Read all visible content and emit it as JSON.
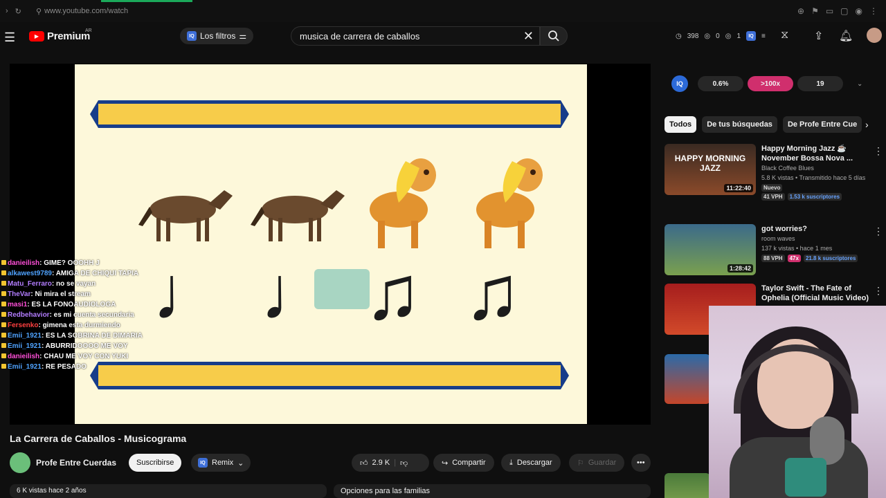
{
  "browser": {
    "url": "www.youtube.com/watch"
  },
  "header": {
    "logo_text": "Premium",
    "logo_region": "AR",
    "filters_label": "Los filtros",
    "search_value": "musica de carrera de caballos",
    "stats": {
      "views": "398",
      "a": "0",
      "b": "1"
    }
  },
  "video": {
    "title": "La Carrera de Caballos - Musicograma",
    "channel": "Profe Entre Cuerdas",
    "subscribe_label": "Suscribirse",
    "remix_label": "Remix",
    "likes": "2.9 K",
    "share_label": "Compartir",
    "download_label": "Descargar",
    "save_label": "Guardar",
    "family_options": "Opciones para las familias",
    "desc_meta": "6 K vistas  hace 2 años"
  },
  "chat": [
    {
      "user": "danieilish",
      "msg": ": GIME? OOOHH J",
      "color": "#ff4fd8"
    },
    {
      "user": "alkawest9789",
      "msg": ": AMIGA DE CHIQUI TAPIA",
      "color": "#4fa3ff"
    },
    {
      "user": "Matu_Ferraro",
      "msg": ": no se vayan",
      "color": "#b37dff"
    },
    {
      "user": "TheVar",
      "msg": ": Ni mira el stream",
      "color": "#b37dff"
    },
    {
      "user": "masi1",
      "msg": ": ES LA FONOAUDIOLOGA",
      "color": "#ff4fd8"
    },
    {
      "user": "Redbehavior",
      "msg": ": es mi cuenta secundaria",
      "color": "#b37dff"
    },
    {
      "user": "Fersenko",
      "msg": ": gimena esta durmiendo",
      "color": "#ff4040"
    },
    {
      "user": "Emii_1921",
      "msg": ": ES LA SOBRINA DE DIMARIA",
      "color": "#4fa3ff"
    },
    {
      "user": "Emii_1921",
      "msg": ": ABURRIDOOOO ME VOY",
      "color": "#4fa3ff"
    },
    {
      "user": "danieilish",
      "msg": ": CHAU ME VOY CON YUKI",
      "color": "#ff4fd8"
    },
    {
      "user": "Emii_1921",
      "msg": ": RE PESADO",
      "color": "#4fa3ff"
    }
  ],
  "iq": {
    "logo": "IQ",
    "pct": "0.6%",
    "ratio": ">100x",
    "count": "19"
  },
  "chips": [
    "Todos",
    "De tus búsquedas",
    "De Profe Entre Cue"
  ],
  "suggestions": [
    {
      "title": "Happy Morning Jazz ☕ November Bossa Nova ...",
      "channel": "Black Coffee Blues",
      "meta": "5.8 K vistas • Transmitido hace 5 días",
      "badge": "Nuevo",
      "vph": "41 VPH",
      "subs": "1.53 k suscriptores",
      "duration": "11:22:40",
      "thumb_text": "HAPPY MORNING JAZZ"
    },
    {
      "title": "got worries?",
      "channel": "room waves",
      "meta": "137 k vistas • hace 1 mes",
      "vph": "88 VPH",
      "mult": "47x",
      "subs": "21.8 k suscriptores",
      "duration": "1:28:42"
    },
    {
      "title": "Taylor Swift - The Fate of Ophelia (Official Music Video)"
    }
  ],
  "colors": {
    "accent_red": "#ff0000",
    "banner_yellow": "#f7cc4a",
    "banner_blue": "#173d8a",
    "slide_bg": "#fdf8da"
  }
}
